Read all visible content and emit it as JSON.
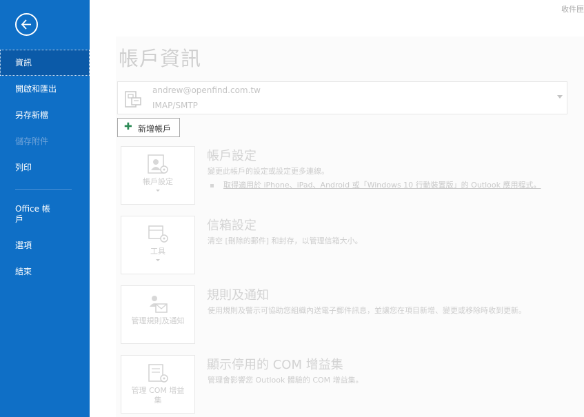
{
  "sidebar": {
    "items": [
      {
        "label": "資訊",
        "active": true
      },
      {
        "label": "開啟和匯出"
      },
      {
        "label": "另存新檔"
      },
      {
        "label": "儲存附件",
        "disabled": true
      },
      {
        "label": "列印"
      },
      {
        "label": "Office 帳\n戶"
      },
      {
        "label": "選項"
      },
      {
        "label": "結束"
      }
    ]
  },
  "header": {
    "top_right": "收件匣"
  },
  "main": {
    "title": "帳戶資訊",
    "account": {
      "email": "andrew@openfind.com.tw",
      "type": "IMAP/SMTP"
    },
    "add_account_label": "新增帳戶",
    "sections": [
      {
        "tile_label": "帳戶設定",
        "title": "帳戶設定",
        "desc": "變更此帳戶的設定或設定更多連線。",
        "link": "取得適用於 iPhone、iPad、Android 或「Windows 10 行動裝置版」的 Outlook 應用程式。"
      },
      {
        "tile_label": "工具",
        "title": "信箱設定",
        "desc": "清空 [刪除的郵件] 和封存，以管理信箱大小。"
      },
      {
        "tile_label": "管理規則及通知",
        "title": "規則及通知",
        "desc": "使用規則及警示可協助您組織內送電子郵件訊息，並讓您在項目新增、變更或移除時收到更新。"
      },
      {
        "tile_label": "管理 COM 增益\n集",
        "title": "顯示停用的 COM 增益集",
        "desc": "管理會影響您 Outlook 體驗的 COM 增益集。"
      }
    ]
  },
  "colors": {
    "sidebar_bg": "#0f6fc6",
    "sidebar_active": "#0b5aa8"
  }
}
